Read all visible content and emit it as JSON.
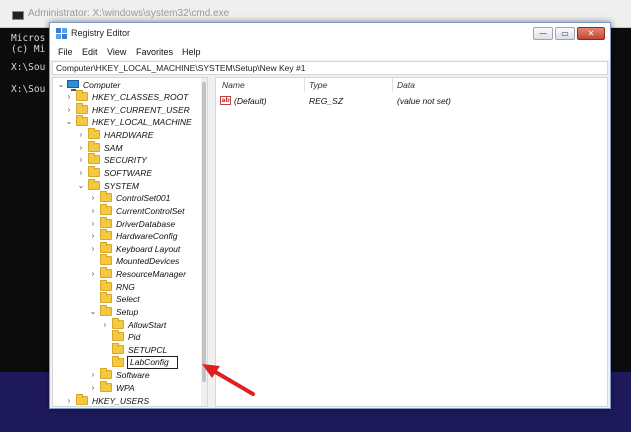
{
  "cmd_window": {
    "title": "Administrator: X:\\windows\\system32\\cmd.exe",
    "lines": [
      "Micros",
      "(c) Mi",
      "",
      "X:\\Sou",
      "",
      "X:\\Sou"
    ]
  },
  "regedit": {
    "title": "Registry Editor",
    "buttons": {
      "minimize": "—",
      "maximize": "▭",
      "close": "✕"
    },
    "menu": [
      "File",
      "Edit",
      "View",
      "Favorites",
      "Help"
    ],
    "address": "Computer\\HKEY_LOCAL_MACHINE\\SYSTEM\\Setup\\New Key #1",
    "tree": {
      "root": "Computer",
      "items": [
        {
          "label": "HKEY_CLASSES_ROOT",
          "chev": ">"
        },
        {
          "label": "HKEY_CURRENT_USER",
          "chev": ">"
        },
        {
          "label": "HKEY_LOCAL_MACHINE",
          "chev": "v"
        },
        {
          "label": "HARDWARE",
          "chev": ">"
        },
        {
          "label": "SAM",
          "chev": ">"
        },
        {
          "label": "SECURITY",
          "chev": ">"
        },
        {
          "label": "SOFTWARE",
          "chev": ">"
        },
        {
          "label": "SYSTEM",
          "chev": "v"
        },
        {
          "label": "ControlSet001",
          "chev": ">"
        },
        {
          "label": "CurrentControlSet",
          "chev": ">"
        },
        {
          "label": "DriverDatabase",
          "chev": ">"
        },
        {
          "label": "HardwareConfig",
          "chev": ">"
        },
        {
          "label": "Keyboard Layout",
          "chev": ">"
        },
        {
          "label": "MountedDevices",
          "chev": ""
        },
        {
          "label": "ResourceManager",
          "chev": ">"
        },
        {
          "label": "RNG",
          "chev": ""
        },
        {
          "label": "Select",
          "chev": ""
        },
        {
          "label": "Setup",
          "chev": "v"
        },
        {
          "label": "AllowStart",
          "chev": ">"
        },
        {
          "label": "Pid",
          "chev": ""
        },
        {
          "label": "SETUPCL",
          "chev": ""
        },
        {
          "label": "LabConfig",
          "chev": ""
        },
        {
          "label": "Software",
          "chev": ">"
        },
        {
          "label": "WPA",
          "chev": ">"
        },
        {
          "label": "HKEY_USERS",
          "chev": ">"
        }
      ],
      "editing_value": "LabConfig"
    },
    "list": {
      "headers": [
        "Name",
        "Type",
        "Data"
      ],
      "rows": [
        {
          "icon": "ab",
          "name": "(Default)",
          "type": "REG_SZ",
          "data": "(value not set)"
        }
      ]
    }
  },
  "colors": {
    "desktop": "#1f1a5c",
    "arrow": "#e02020",
    "folder": "#f5c842"
  }
}
